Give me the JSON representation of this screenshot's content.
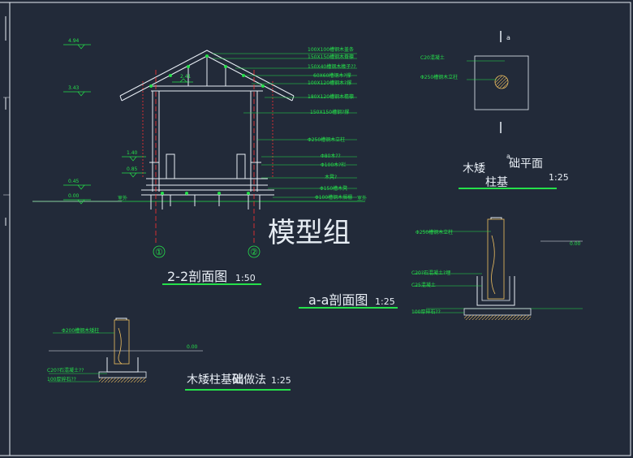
{
  "watermark": "模型组",
  "section_22": {
    "title": "2-2剖面图",
    "scale": "1:50",
    "levels": [
      "4.94",
      "3.43",
      "2.41",
      "1.40",
      "0.85",
      "0.45",
      "0.00"
    ],
    "labels": [
      "100X100槽钢木盖条",
      "150X150槽钢木脊檩",
      "150X40槽钢木椽子??",
      "60X60槽钢木?撑",
      "100X120槽钢木?撑",
      "180X120槽钢木檐檩",
      "150X150槽钢?撑",
      "Φ250槽钢木立柱",
      "Φ80木??",
      "Φ100木?栏",
      "木凳?",
      "Φ150槽木凳",
      "Φ100槽钢木搁栅"
    ],
    "ground_label": "室外",
    "ground_label_right": "室外",
    "axis_1": "①",
    "axis_2": "②"
  },
  "plan": {
    "section_mark": "a",
    "section_mark_lower": "a",
    "labels": [
      "C20混凝土",
      "Φ250槽钢木立柱"
    ],
    "title_a": "木矮",
    "title_b": "柱基",
    "title_c": "础平面",
    "scale": "1:25"
  },
  "section_aa": {
    "title": "a-a剖面图",
    "scale": "1:25",
    "labels": [
      "Φ250槽钢木立柱",
      "C20?石混凝土?埋",
      "C25混凝土",
      "100厚碎石??"
    ],
    "level": "0.00"
  },
  "detail": {
    "title_a": "木矮柱基",
    "title_b": "础",
    "title_c": "做法",
    "scale": "1:25",
    "labels": [
      "Φ200槽钢木矮柱",
      "C20?石混凝土??",
      "100厚碎石??"
    ],
    "level": "0.00"
  }
}
